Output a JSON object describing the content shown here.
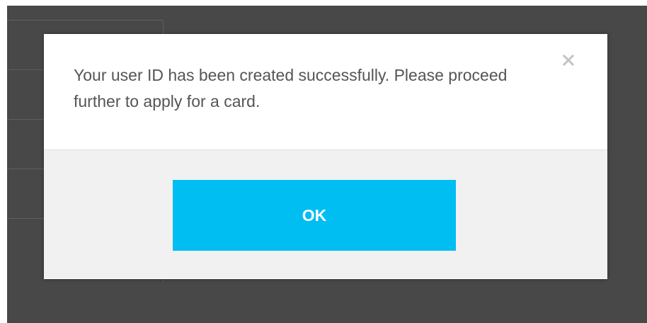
{
  "modal": {
    "message": "Your user ID has been created successfully. Please proceed further to apply for a card.",
    "close_icon": "close-icon",
    "ok_label": "OK"
  },
  "colors": {
    "backdrop": "#484848",
    "modal_background": "#ffffff",
    "footer_background": "#f1f1f1",
    "button_primary": "#00bdf2",
    "message_text": "#555555",
    "close_icon": "#c4c4c4"
  }
}
